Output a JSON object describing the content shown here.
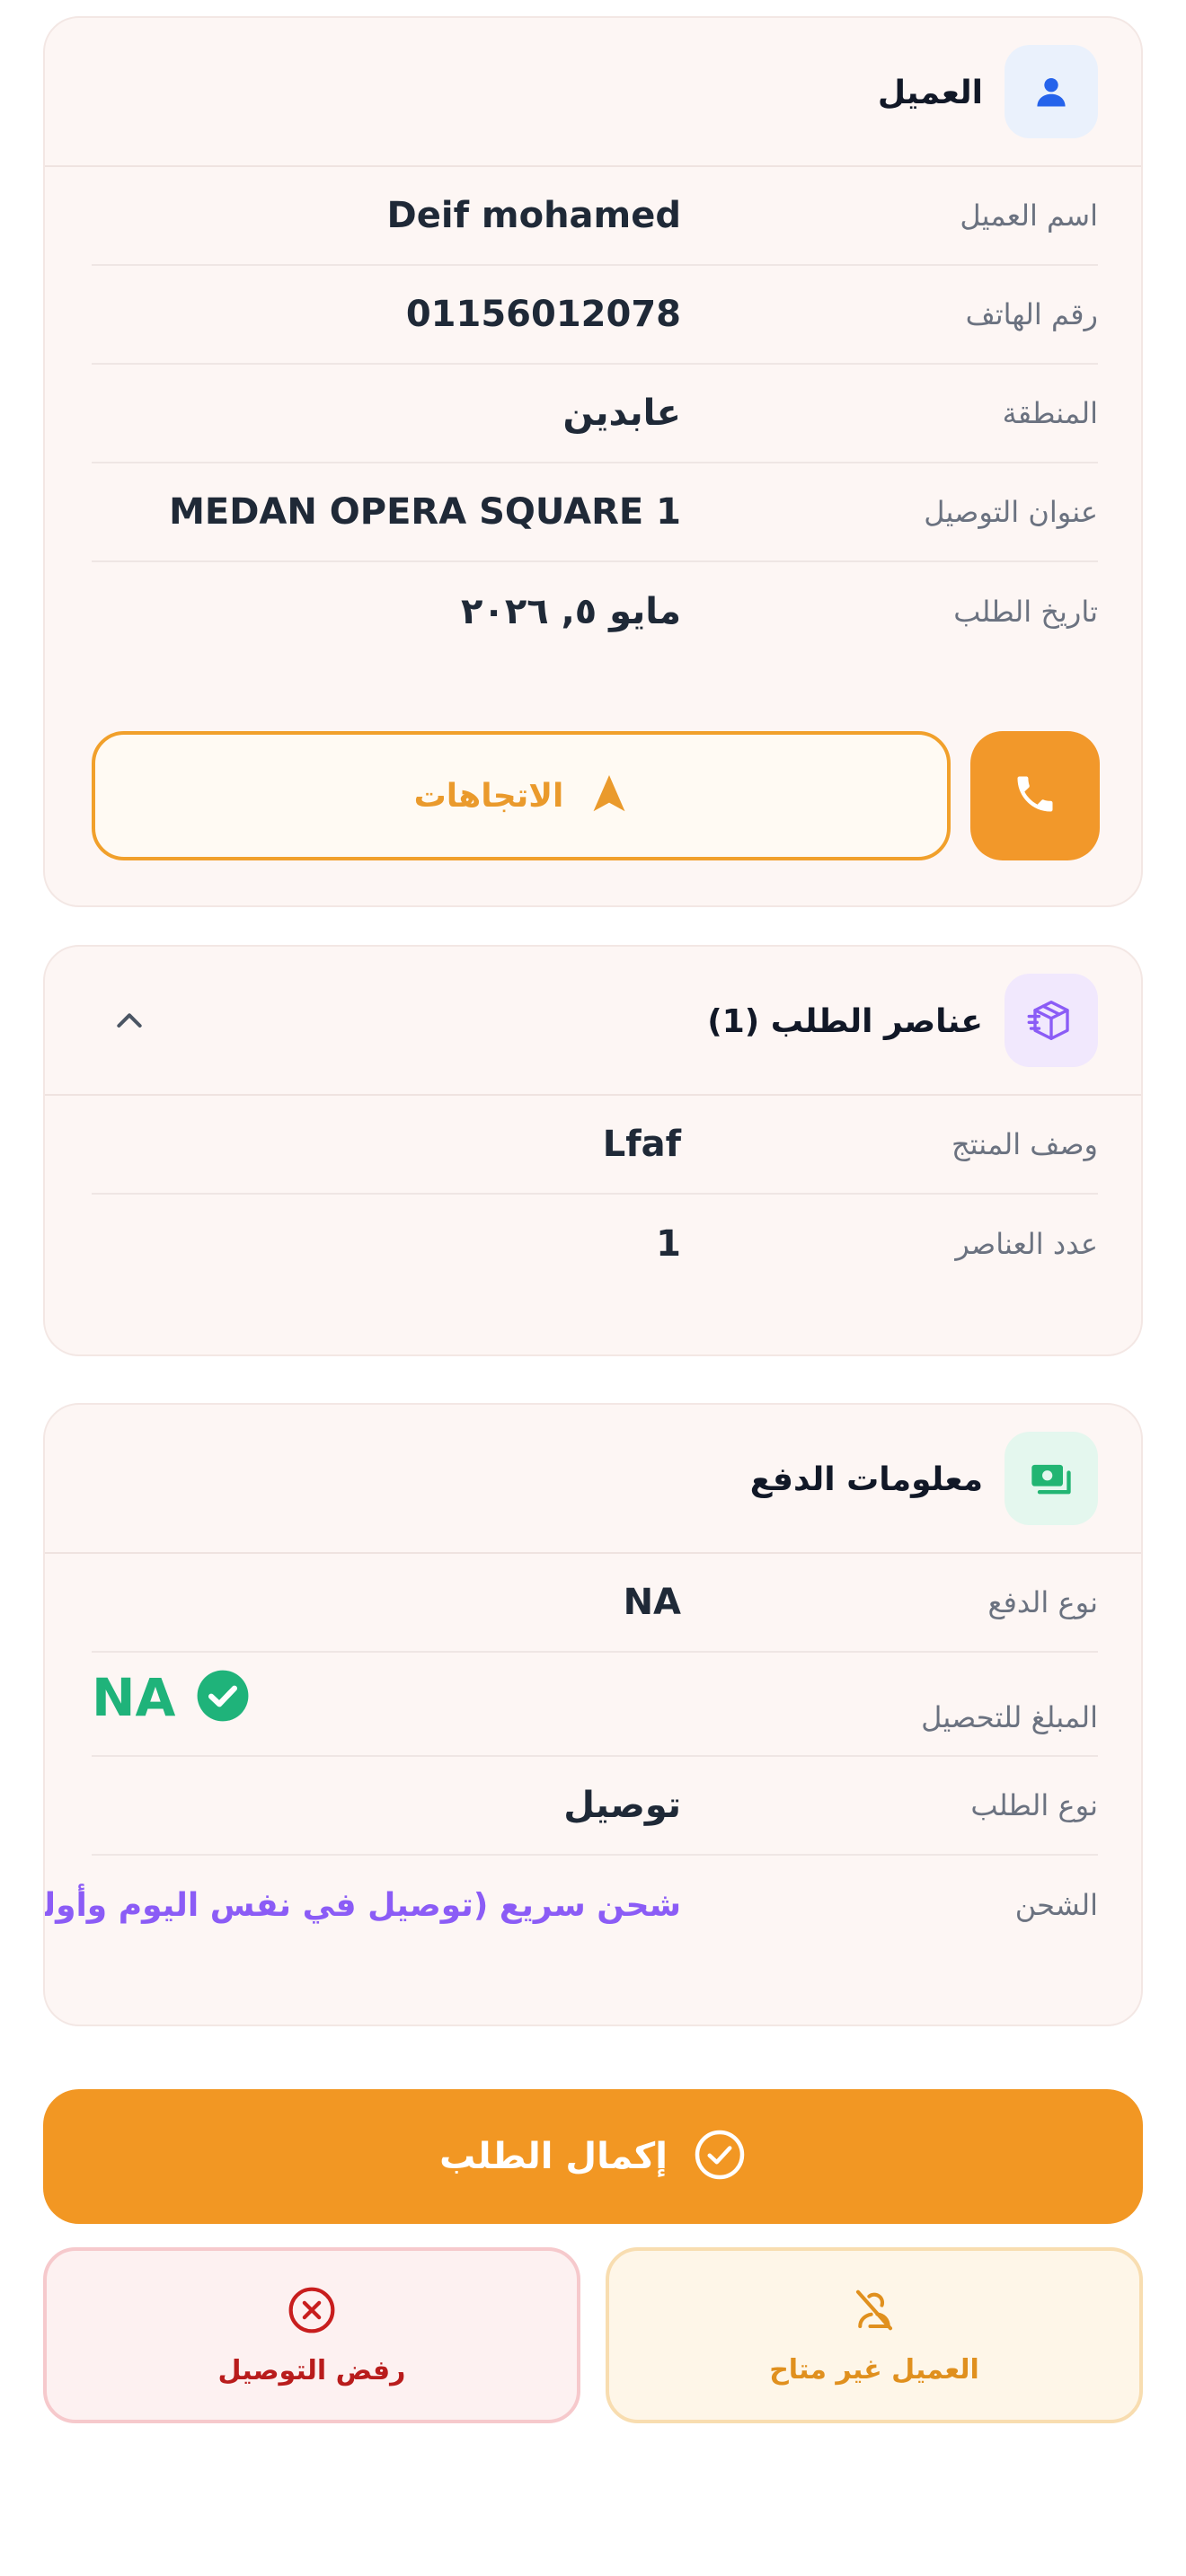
{
  "customer_card": {
    "title": "العميل",
    "rows": [
      {
        "label": "اسم العميل",
        "value": "Deif mohamed"
      },
      {
        "label": "رقم الهاتف",
        "value": "01156012078"
      },
      {
        "label": "المنطقة",
        "value": "عابدين"
      },
      {
        "label": "عنوان التوصيل",
        "value": "MEDAN OPERA SQUARE 1"
      },
      {
        "label": "تاريخ الطلب",
        "value": "مايو ٥, ٢٠٢٦"
      }
    ],
    "directions_label": "الاتجاهات",
    "icons": {
      "header": "user-icon",
      "directions": "navigation-icon",
      "call": "phone-icon"
    }
  },
  "items_card": {
    "title": "عناصر الطلب (1)",
    "rows": [
      {
        "label": "وصف المنتج",
        "value": "Lfaf"
      },
      {
        "label": "عدد العناصر",
        "value": "1"
      }
    ],
    "icons": {
      "header": "package-icon",
      "toggle": "chevron-up-icon"
    }
  },
  "payment_card": {
    "title": "معلومات الدفع",
    "payment_type": {
      "label": "نوع الدفع",
      "value": "NA"
    },
    "amount": {
      "label": "المبلغ للتحصيل",
      "value": "NA"
    },
    "order_type": {
      "label": "نوع الطلب",
      "value": "توصيل"
    },
    "shipping": {
      "label": "الشحن",
      "value": "شحن سريع (توصيل في نفس اليوم وأولوية)"
    },
    "icons": {
      "header": "cash-icon",
      "amount_status": "check-circle-icon"
    }
  },
  "actions": {
    "complete_label": "إكمال الطلب",
    "reject_label": "رفض التوصيل",
    "unavailable_label": "العميل غير متاح",
    "icons": {
      "complete": "check-circle-icon",
      "reject": "x-circle-icon",
      "unavailable": "user-off-icon"
    }
  },
  "colors": {
    "accent": "#f29723",
    "success": "#1fb37a",
    "danger": "#b91c1c",
    "purple": "#8b5cf6",
    "card_bg": "#fdf6f4"
  }
}
